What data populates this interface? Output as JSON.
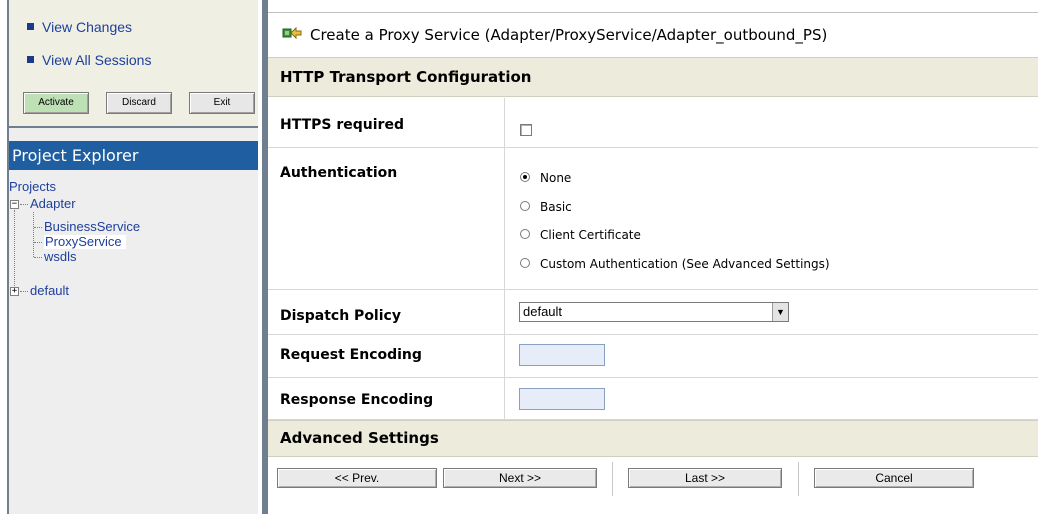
{
  "change_center": {
    "links": [
      {
        "label": "View Changes"
      },
      {
        "label": "View All Sessions"
      }
    ],
    "buttons": {
      "activate": "Activate",
      "discard": "Discard",
      "exit": "Exit"
    }
  },
  "project_explorer": {
    "title": "Project Explorer",
    "root": "Projects",
    "tree": {
      "adapter": {
        "label": "Adapter",
        "expander": "−",
        "children": [
          "BusinessService",
          "ProxyService",
          "wsdls"
        ]
      },
      "default": {
        "label": "default",
        "expander": "+"
      },
      "selected": "ProxyService"
    }
  },
  "page": {
    "title": "Create a Proxy Service (Adapter/ProxyService/Adapter_outbound_PS)",
    "title_icon": "proxy-service-icon",
    "section_http": "HTTP Transport Configuration",
    "section_advanced": "Advanced Settings"
  },
  "form": {
    "https_required": {
      "label": "HTTPS required",
      "checked": false
    },
    "authentication": {
      "label": "Authentication",
      "options": [
        "None",
        "Basic",
        "Client Certificate",
        "Custom Authentication (See Advanced Settings)"
      ],
      "selected": "None"
    },
    "dispatch_policy": {
      "label": "Dispatch Policy",
      "value": "default"
    },
    "request_encoding": {
      "label": "Request Encoding",
      "value": ""
    },
    "response_encoding": {
      "label": "Response Encoding",
      "value": ""
    }
  },
  "footer": {
    "prev": "<< Prev.",
    "next": "Next >>",
    "last": "Last >>",
    "cancel": "Cancel"
  },
  "colors": {
    "header_blue": "#1f5ea0",
    "link_blue": "#1e3f9b",
    "band_beige": "#ecebdc",
    "activate_green": "#bde0b4",
    "panel_beige": "#efefe4"
  }
}
